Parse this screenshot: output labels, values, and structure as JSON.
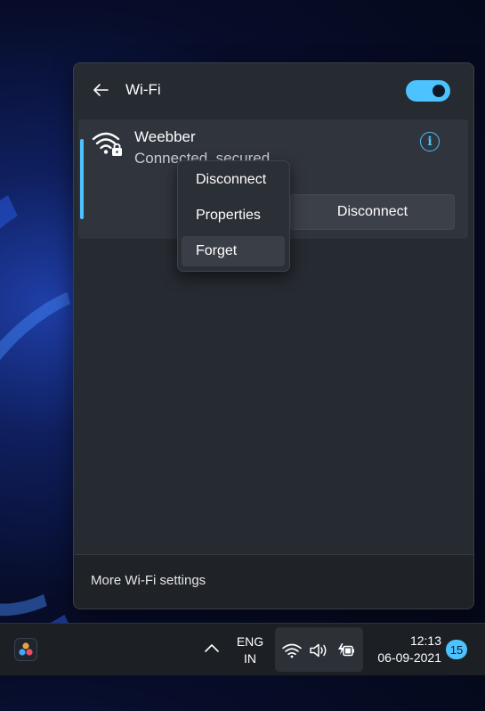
{
  "wifi_panel": {
    "title": "Wi-Fi",
    "toggle_state": "on",
    "network": {
      "name": "Weebber",
      "status": "Connected, secured",
      "disconnect_label": "Disconnect",
      "info_label": "i"
    },
    "footer": {
      "more_settings_label": "More Wi-Fi settings"
    }
  },
  "context_menu": {
    "items": [
      {
        "label": "Disconnect"
      },
      {
        "label": "Properties"
      },
      {
        "label": "Forget"
      }
    ]
  },
  "taskbar": {
    "language": {
      "line1": "ENG",
      "line2": "IN"
    },
    "clock": {
      "time": "12:13",
      "date": "06-09-2021"
    },
    "notification_count": "15"
  },
  "colors": {
    "accent": "#4cc2ff",
    "panel_bg": "#262a31",
    "card_bg": "#30343c"
  }
}
